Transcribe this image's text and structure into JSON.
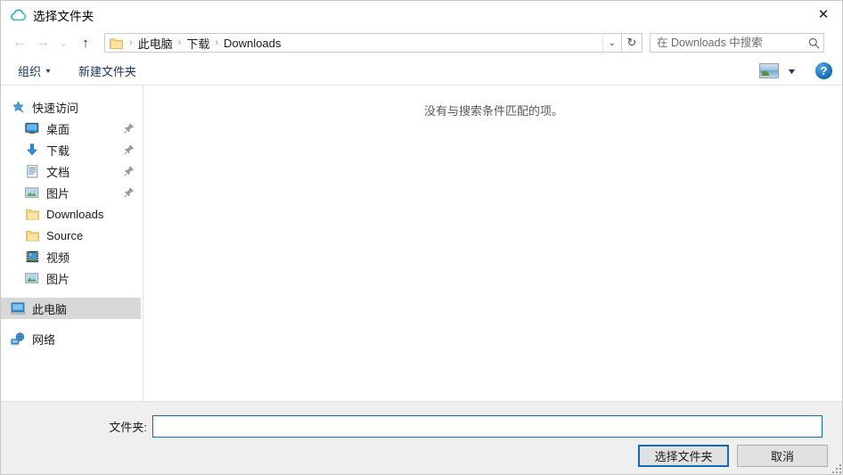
{
  "window": {
    "title": "选择文件夹",
    "title_icon": "cloud-icon",
    "close_label": "✕"
  },
  "navbar": {
    "back_icon": "←",
    "forward_icon": "→",
    "recent_icon": "⌄",
    "up_icon": "↑",
    "folder_icon": "folder-icon",
    "breadcrumb": [
      "此电脑",
      "下载",
      "Downloads"
    ],
    "separator": "›",
    "dropdown_icon": "⌄",
    "refresh_icon": "↻",
    "search": {
      "placeholder": "在 Downloads 中搜索",
      "value": "",
      "icon": "search-icon"
    }
  },
  "commandbar": {
    "organize_label": "组织",
    "organize_caret": "▾",
    "new_folder_label": "新建文件夹",
    "view_icon": "view-mode-icon",
    "view_caret": "▼",
    "help_label": "?"
  },
  "navpane": {
    "items": [
      {
        "label": "快速访问",
        "icon": "star-pin-icon",
        "level": 0,
        "pinned": false,
        "selected": false
      },
      {
        "label": "桌面",
        "icon": "desktop-icon",
        "level": 1,
        "pinned": true,
        "selected": false
      },
      {
        "label": "下载",
        "icon": "download-arrow-icon",
        "level": 1,
        "pinned": true,
        "selected": false
      },
      {
        "label": "文档",
        "icon": "document-icon",
        "level": 1,
        "pinned": true,
        "selected": false
      },
      {
        "label": "图片",
        "icon": "picture-icon",
        "level": 1,
        "pinned": true,
        "selected": false
      },
      {
        "label": "Downloads",
        "icon": "folder-icon",
        "level": 1,
        "pinned": false,
        "selected": false
      },
      {
        "label": "Source",
        "icon": "folder-icon",
        "level": 1,
        "pinned": false,
        "selected": false
      },
      {
        "label": "视频",
        "icon": "video-icon",
        "level": 1,
        "pinned": false,
        "selected": false
      },
      {
        "label": "图片",
        "icon": "picture-icon",
        "level": 1,
        "pinned": false,
        "selected": false
      },
      {
        "label": "此电脑",
        "icon": "this-pc-icon",
        "level": 0,
        "pinned": false,
        "selected": true
      },
      {
        "label": "网络",
        "icon": "network-icon",
        "level": 0,
        "pinned": false,
        "selected": false
      }
    ]
  },
  "filelist": {
    "empty_message": "没有与搜索条件匹配的项。"
  },
  "footer": {
    "foldername_label": "文件夹:",
    "foldername_value": "",
    "confirm_label": "选择文件夹",
    "cancel_label": "取消"
  },
  "colors": {
    "accent": "#0f6cbd",
    "folder_yellow": "#fcd77f",
    "selection_grey": "#d8d8d8",
    "footer_grey": "#efefef",
    "link_blue": "#1a3a6b"
  }
}
